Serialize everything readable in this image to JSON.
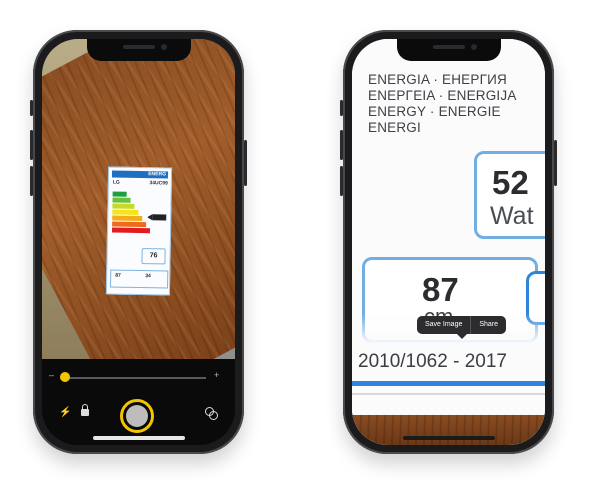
{
  "left_phone": {
    "energy_label": {
      "header": "ENERG",
      "brand": "LG",
      "model": "34UC99",
      "power_value": "76",
      "size_value": "87",
      "size_unit": "cm",
      "screen_value": "34",
      "bar_colors": [
        "#1e9e3e",
        "#6cbf3a",
        "#c8d929",
        "#f4e51a",
        "#f4ac1a",
        "#ef6a1c",
        "#e31b23"
      ]
    },
    "camera": {
      "zoom_minus": "–",
      "zoom_plus": "+",
      "flash_icon": "⚡"
    }
  },
  "right_phone": {
    "energy_heading": [
      "ENERGIA · ЕНЕРГИЯ",
      "ENEPΓEIA · ENERGIJA",
      "ENERGY · ENERGIE",
      "ENERGI"
    ],
    "power_value": "52",
    "power_unit": "Wat",
    "size_value": "87",
    "size_unit": "cm",
    "regulation": "2010/1062 - 2017",
    "context_menu": {
      "save": "Save Image",
      "share": "Share"
    }
  },
  "colors": {
    "accent": "#f2c500",
    "label_blue": "#2f86d8"
  }
}
